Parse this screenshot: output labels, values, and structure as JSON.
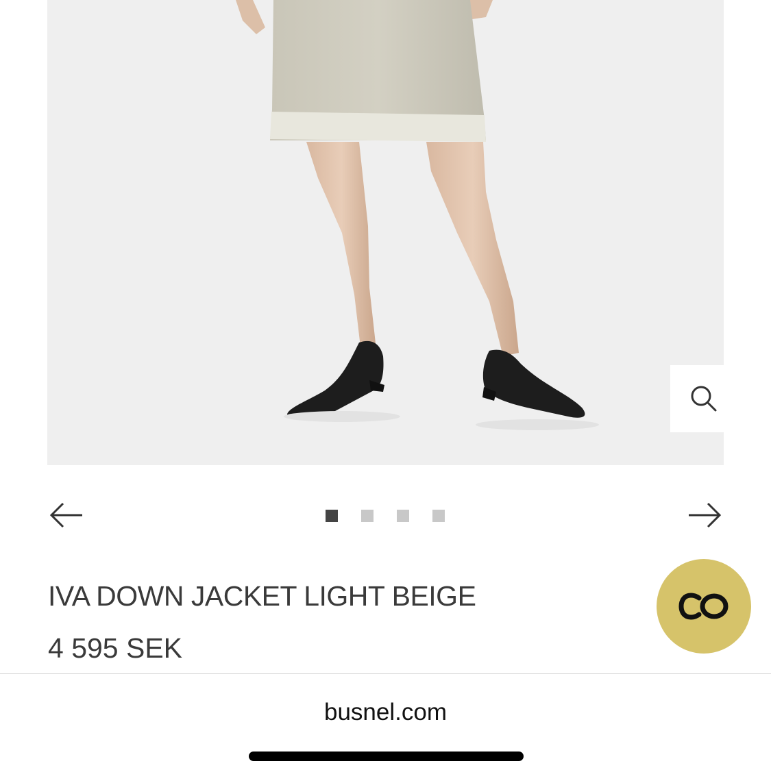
{
  "product": {
    "title": "IVA DOWN JACKET LIGHT BEIGE",
    "price": "4 595 SEK",
    "image": {
      "description_icon": "product-photo",
      "zoom_icon": "search-icon"
    }
  },
  "carousel": {
    "prev_icon": "arrow-left-icon",
    "next_icon": "arrow-right-icon",
    "total_slides": 4,
    "active_slide": 1
  },
  "chat": {
    "icon": "chat-logo-icon",
    "color": "#d6c36a"
  },
  "browser": {
    "url": "busnel.com"
  },
  "colors": {
    "text": "#3a3a3a",
    "dot_active": "#444444",
    "dot_inactive": "#c8c8c8",
    "image_bg": "#efefef"
  }
}
